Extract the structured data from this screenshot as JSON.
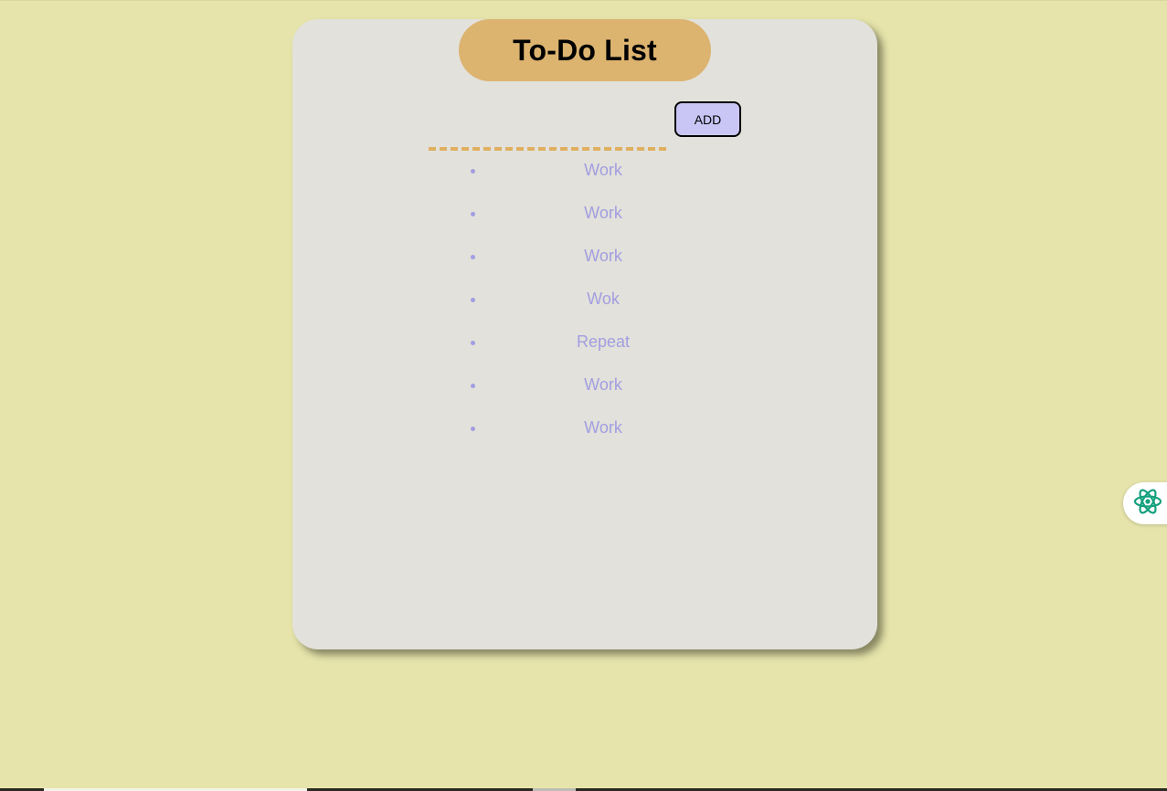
{
  "header": {
    "title": "To-Do List"
  },
  "input": {
    "value": "",
    "placeholder": ""
  },
  "add_button": {
    "label": "ADD"
  },
  "tasks": [
    "Work",
    "Work",
    "Work",
    "Wok",
    "Repeat",
    "Work",
    "Work"
  ],
  "colors": {
    "page_background": "#e6e4ab",
    "card_background": "#e2e1db",
    "title_pill": "#dcb36f",
    "input_underline": "#e0b060",
    "button_background": "#c9c6f5",
    "task_text": "#a29ee0",
    "widget_icon": "#13a07d"
  },
  "icons": {
    "side_widget": "atom-icon"
  }
}
